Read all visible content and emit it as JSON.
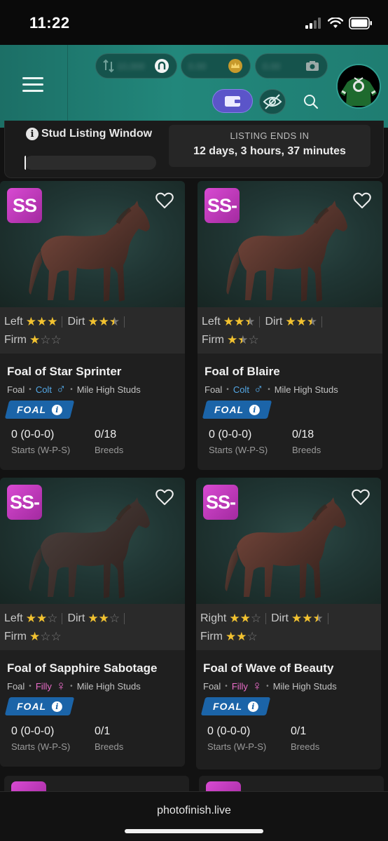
{
  "status_bar": {
    "time": "11:22"
  },
  "header": {
    "balances": [
      {
        "value": "10,000",
        "icon": "horseshoe-icon"
      },
      {
        "value": "0.00",
        "icon": "crown-coin-icon"
      },
      {
        "value": "0.00",
        "icon": "camera-icon"
      }
    ]
  },
  "listing": {
    "title": "Stud Listing Window",
    "progress": 0.01,
    "ends_label": "LISTING ENDS IN",
    "ends_value": "12 days, 3 hours, 37 minutes"
  },
  "cards": [
    {
      "grade": "SS",
      "surfaces": [
        {
          "label": "Left",
          "stars": [
            1,
            1,
            1
          ]
        },
        {
          "label": "Dirt",
          "stars": [
            1,
            1,
            0.5
          ]
        },
        {
          "label": "Firm",
          "stars": [
            1,
            0,
            0
          ]
        }
      ],
      "name": "Foal of Star Sprinter",
      "type": "Foal",
      "sex": "Colt",
      "sex_symbol": "♂",
      "stable": "Mile High Studs",
      "tag": "FOAL",
      "record": "0 (0-0-0)",
      "record_label": "Starts (W-P-S)",
      "breeds": "0/18",
      "breeds_label": "Breeds",
      "horse_color": "#7b4a3e"
    },
    {
      "grade": "SS-",
      "surfaces": [
        {
          "label": "Left",
          "stars": [
            1,
            1,
            0.5
          ]
        },
        {
          "label": "Dirt",
          "stars": [
            1,
            1,
            0.5
          ]
        },
        {
          "label": "Firm",
          "stars": [
            1,
            0.5,
            0
          ]
        }
      ],
      "name": "Foal of Blaire",
      "type": "Foal",
      "sex": "Colt",
      "sex_symbol": "♂",
      "stable": "Mile High Studs",
      "tag": "FOAL",
      "record": "0 (0-0-0)",
      "record_label": "Starts (W-P-S)",
      "breeds": "0/18",
      "breeds_label": "Breeds",
      "horse_color": "#7b4a3e"
    },
    {
      "grade": "SS-",
      "surfaces": [
        {
          "label": "Left",
          "stars": [
            1,
            1,
            0
          ]
        },
        {
          "label": "Dirt",
          "stars": [
            1,
            1,
            0
          ]
        },
        {
          "label": "Firm",
          "stars": [
            1,
            0,
            0
          ]
        }
      ],
      "name": "Foal of Sapphire Sabotage",
      "type": "Foal",
      "sex": "Filly",
      "sex_symbol": "♀",
      "stable": "Mile High Studs",
      "tag": "FOAL",
      "record": "0 (0-0-0)",
      "record_label": "Starts (W-P-S)",
      "breeds": "0/1",
      "breeds_label": "Breeds",
      "horse_color": "#4e4340"
    },
    {
      "grade": "SS-",
      "surfaces": [
        {
          "label": "Right",
          "stars": [
            1,
            1,
            0
          ]
        },
        {
          "label": "Dirt",
          "stars": [
            1,
            1,
            0.5
          ]
        },
        {
          "label": "Firm",
          "stars": [
            1,
            1,
            0
          ]
        }
      ],
      "name": "Foal of Wave of Beauty",
      "type": "Foal",
      "sex": "Filly",
      "sex_symbol": "♀",
      "stable": "Mile High Studs",
      "tag": "FOAL",
      "record": "0 (0-0-0)",
      "record_label": "Starts (W-P-S)",
      "breeds": "0/1",
      "breeds_label": "Breeds",
      "horse_color": "#7b4a3e"
    }
  ],
  "browser": {
    "url": "photofinish.live"
  }
}
